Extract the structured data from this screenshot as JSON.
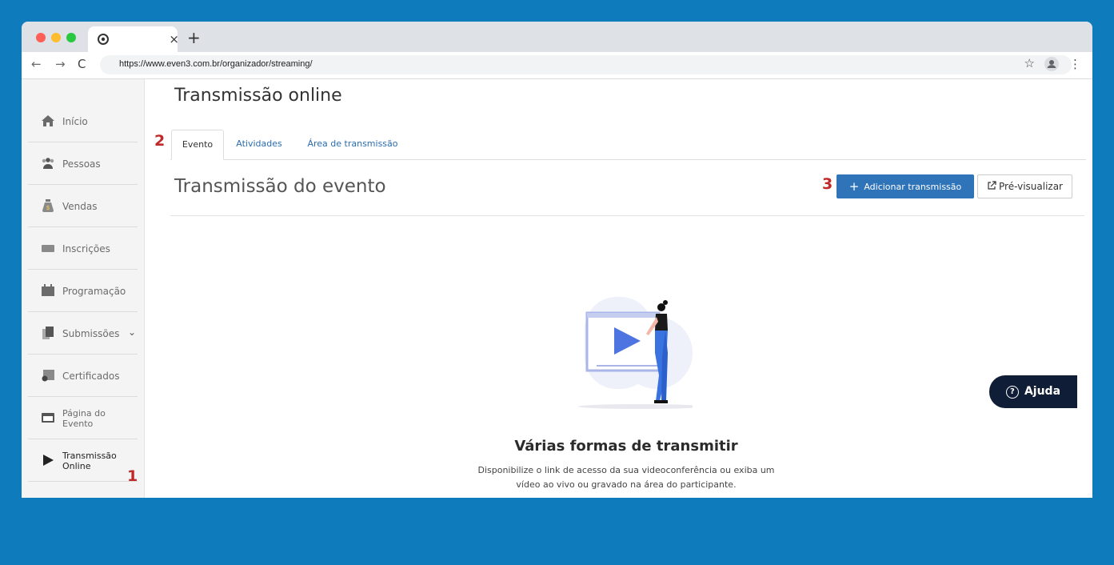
{
  "browser": {
    "tab_close": "×",
    "new_tab": "+",
    "back": "←",
    "forward": "→",
    "reload": "C",
    "url": "https://www.even3.com.br/organizador/streaming/",
    "star": "☆",
    "menu": "⋮"
  },
  "sidebar": {
    "items": [
      {
        "label": "Início",
        "icon": "home-icon"
      },
      {
        "label": "Pessoas",
        "icon": "people-icon"
      },
      {
        "label": "Vendas",
        "icon": "money-bag-icon"
      },
      {
        "label": "Inscrições",
        "icon": "ticket-icon"
      },
      {
        "label": "Programação",
        "icon": "calendar-icon"
      },
      {
        "label": "Submissões",
        "icon": "document-icon"
      },
      {
        "label": "Certificados",
        "icon": "certificate-icon"
      },
      {
        "label_line1": "Página do",
        "label_line2": "Evento",
        "icon": "browser-page-icon"
      },
      {
        "label_line1": "Transmissão",
        "label_line2": "Online",
        "icon": "play-icon"
      }
    ],
    "chevron": "⌄"
  },
  "main": {
    "title": "Transmissão online",
    "tabs": [
      "Evento",
      "Atividades",
      "Área de transmissão"
    ],
    "section_title": "Transmissão do evento",
    "add_button": "Adicionar transmissão",
    "add_plus": "+",
    "preview_button": "Pré-visualizar",
    "empty_title": "Várias formas de transmitir",
    "empty_desc_line1": "Disponibilize o link de acesso da sua videoconferência ou exiba um",
    "empty_desc_line2": "vídeo ao vivo ou gravado na área do participante."
  },
  "annotations": [
    "1",
    "2",
    "3"
  ],
  "help": {
    "label": "Ajuda",
    "q": "?"
  },
  "colors": {
    "background": "#0e7bbd",
    "primary": "#2f73b8",
    "annotation": "#c0292a",
    "help": "#0f1e36"
  }
}
